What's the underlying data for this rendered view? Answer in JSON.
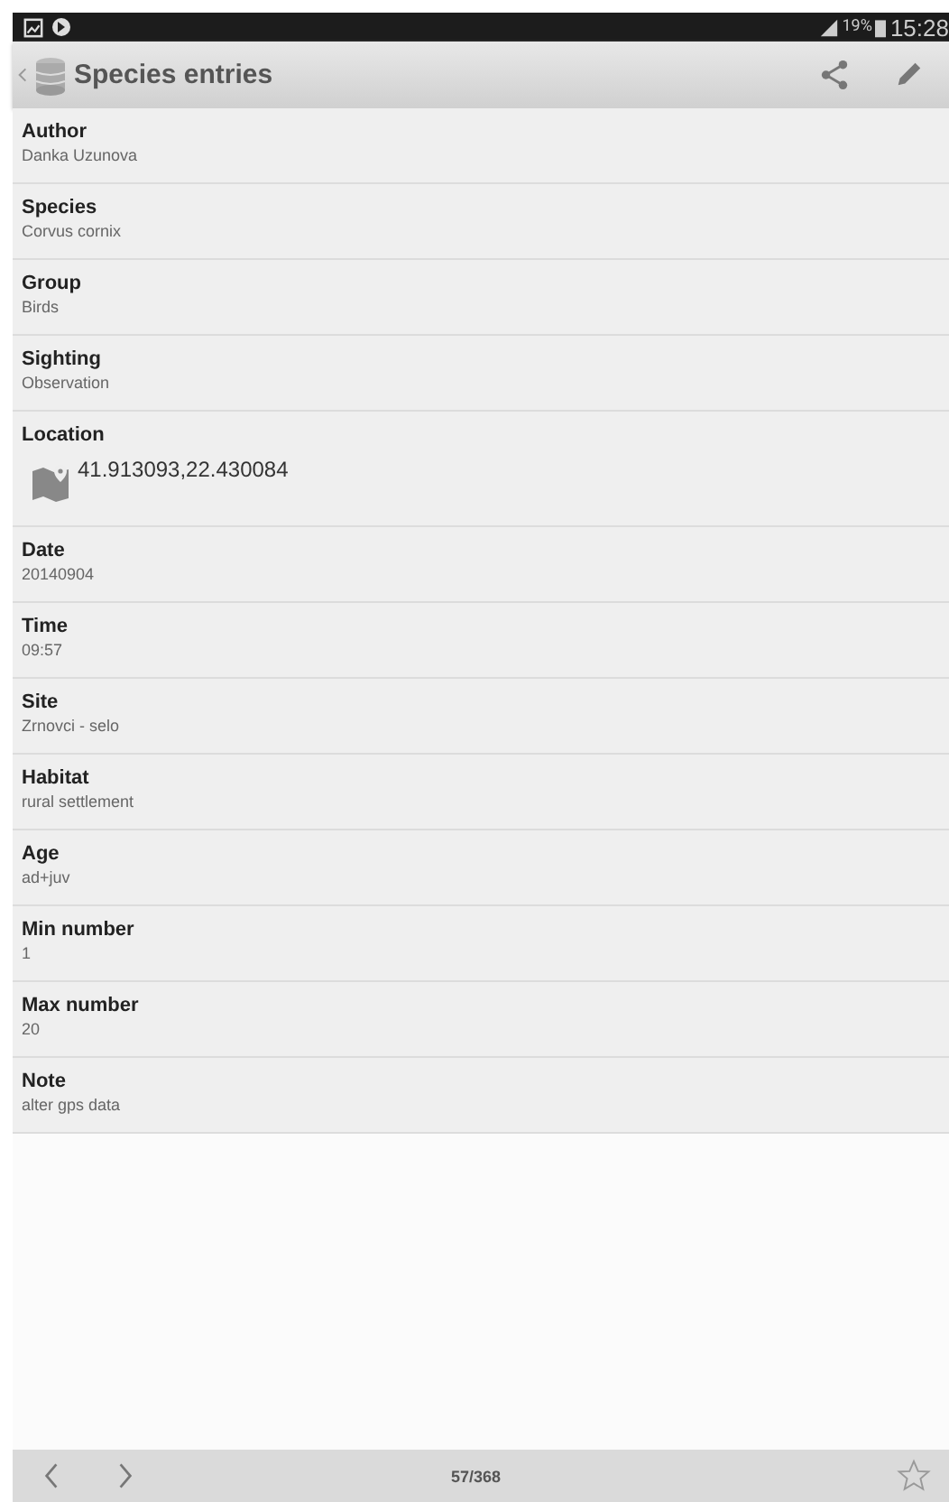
{
  "status_bar": {
    "battery": "19%",
    "time": "15:28"
  },
  "app_bar": {
    "title": "Species entries"
  },
  "fields": [
    {
      "kind": "text",
      "label": "Author",
      "value": "Danka Uzunova"
    },
    {
      "kind": "text",
      "label": "Species",
      "value": "Corvus cornix"
    },
    {
      "kind": "text",
      "label": "Group",
      "value": "Birds"
    },
    {
      "kind": "text",
      "label": "Sighting",
      "value": "Observation"
    },
    {
      "kind": "location",
      "label": "Location",
      "value": "41.913093,22.430084"
    },
    {
      "kind": "text",
      "label": "Date",
      "value": "20140904"
    },
    {
      "kind": "text",
      "label": "Time",
      "value": "09:57"
    },
    {
      "kind": "text",
      "label": "Site",
      "value": "Zrnovci - selo"
    },
    {
      "kind": "text",
      "label": "Habitat",
      "value": "rural settlement"
    },
    {
      "kind": "text",
      "label": "Age",
      "value": "ad+juv"
    },
    {
      "kind": "text",
      "label": "Min number",
      "value": "1"
    },
    {
      "kind": "text",
      "label": "Max number",
      "value": "20"
    },
    {
      "kind": "text",
      "label": "Note",
      "value": "alter gps data"
    }
  ],
  "footer": {
    "counter": "57/368",
    "starred": false
  }
}
